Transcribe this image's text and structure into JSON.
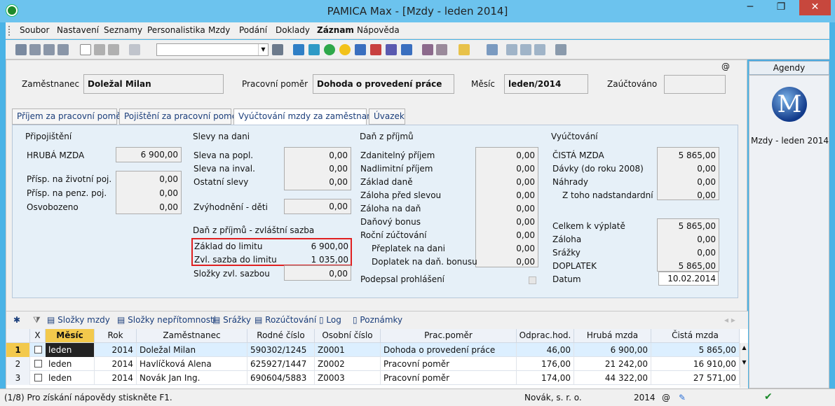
{
  "window": {
    "title": "PAMICA Max - [Mzdy - leden 2014]",
    "minimize": "─",
    "maximize": "❐",
    "close": "✕"
  },
  "menu": [
    "Soubor",
    "Nastavení",
    "Seznamy",
    "Personalistika",
    "Mzdy",
    "Podání",
    "Doklady",
    "Záznam",
    "Nápověda"
  ],
  "header": {
    "employee_label": "Zaměstnanec",
    "employee": "Doležal Milan",
    "relation_label": "Pracovní poměr",
    "relation": "Dohoda o provedení práce",
    "month_label": "Měsíc",
    "month": "leden/2014",
    "posted_label": "Zaúčtováno",
    "posted": "",
    "at": "@"
  },
  "tabs": [
    "Příjem za pracovní poměr",
    "Pojištění za pracovní poměr",
    "Vyúčtování mzdy za zaměstnance",
    "Úvazek"
  ],
  "pripojisteni": {
    "title": "Připojištění",
    "gross_label": "HRUBÁ MZDA",
    "gross": "6 900,00",
    "life_label": "Přísp. na životní poj.",
    "life": "0,00",
    "pension_label": "Přísp. na penz. poj.",
    "pension": "0,00",
    "exempt_label": "Osvobozeno",
    "exempt": "0,00"
  },
  "slevy": {
    "title": "Slevy na dani",
    "s1_label": "Sleva na popl.",
    "s1": "0,00",
    "s2_label": "Sleva na inval.",
    "s2": "0,00",
    "s3_label": "Ostatní slevy",
    "s3": "0,00",
    "kids_label": "Zvýhodnění - děti",
    "kids": "0,00"
  },
  "zvlastni": {
    "title": "Daň z příjmů - zvláštní sazba",
    "base_label": "Základ do limitu",
    "base": "6 900,00",
    "rate_label": "Zvl. sazba do limitu",
    "rate": "1 035,00",
    "parts_label": "Složky zvl. sazbou",
    "parts": "0,00"
  },
  "dan": {
    "title": "Daň z příjmů",
    "rows": [
      {
        "label": "Zdanitelný příjem",
        "value": "0,00"
      },
      {
        "label": "Nadlimitní příjem",
        "value": "0,00"
      },
      {
        "label": "Základ daně",
        "value": "0,00"
      },
      {
        "label": "Záloha před slevou",
        "value": "0,00"
      },
      {
        "label": "Záloha na daň",
        "value": "0,00"
      },
      {
        "label": "Daňový bonus",
        "value": "0,00"
      },
      {
        "label": "Roční zúčtování",
        "value": "0,00"
      },
      {
        "label": "Přeplatek na dani",
        "value": "0,00"
      },
      {
        "label": "Doplatek na daň. bonusu",
        "value": "0,00"
      }
    ],
    "signed_label": "Podepsal prohlášení"
  },
  "vyuctovani": {
    "title": "Vyúčtování",
    "rows": [
      {
        "label": "ČISTÁ MZDA",
        "value": "5 865,00"
      },
      {
        "label": "Dávky (do roku 2008)",
        "value": "0,00"
      },
      {
        "label": "Náhrady",
        "value": "0,00"
      },
      {
        "label": "Z toho nadstandardní",
        "value": "0,00"
      }
    ],
    "rows2": [
      {
        "label": "Celkem k výplatě",
        "value": "5 865,00"
      },
      {
        "label": "Záloha",
        "value": "0,00"
      },
      {
        "label": "Srážky",
        "value": "0,00"
      },
      {
        "label": "DOPLATEK",
        "value": "5 865,00"
      }
    ],
    "date_label": "Datum",
    "date": "10.02.2014"
  },
  "bottom_tabs": [
    "Složky mzdy",
    "Složky nepřítomnosti",
    "Srážky",
    "Rozúčtování",
    "Log",
    "Poznámky"
  ],
  "grid": {
    "headers": [
      "X",
      "Měsíc",
      "Rok",
      "Zaměstnanec",
      "Rodné číslo",
      "Osobní číslo",
      "Prac.poměr",
      "Odprac.hod.",
      "Hrubá mzda",
      "Čistá mzda"
    ],
    "rows": [
      {
        "n": "1",
        "month": "leden",
        "year": "2014",
        "name": "Doležal Milan",
        "rc": "590302/1245",
        "os": "Z0001",
        "pp": "Dohoda o provedení práce",
        "hours": "46,00",
        "gross": "6 900,00",
        "net": "5 865,00"
      },
      {
        "n": "2",
        "month": "leden",
        "year": "2014",
        "name": "Havlíčková Alena",
        "rc": "625927/1447",
        "os": "Z0002",
        "pp": "Pracovní poměr",
        "hours": "176,00",
        "gross": "21 242,00",
        "net": "16 910,00"
      },
      {
        "n": "3",
        "month": "leden",
        "year": "2014",
        "name": "Novák Jan Ing.",
        "rc": "690604/5883",
        "os": "Z0003",
        "pp": "Pracovní poměr",
        "hours": "174,00",
        "gross": "44 322,00",
        "net": "27 571,00"
      }
    ]
  },
  "agendy": {
    "title": "Agendy",
    "caption": "Mzdy - leden 2014",
    "logo": "M"
  },
  "status": {
    "hint": "(1/8) Pro získání nápovědy stiskněte F1.",
    "company": "Novák, s. r. o.",
    "year": "2014",
    "at": "@"
  }
}
